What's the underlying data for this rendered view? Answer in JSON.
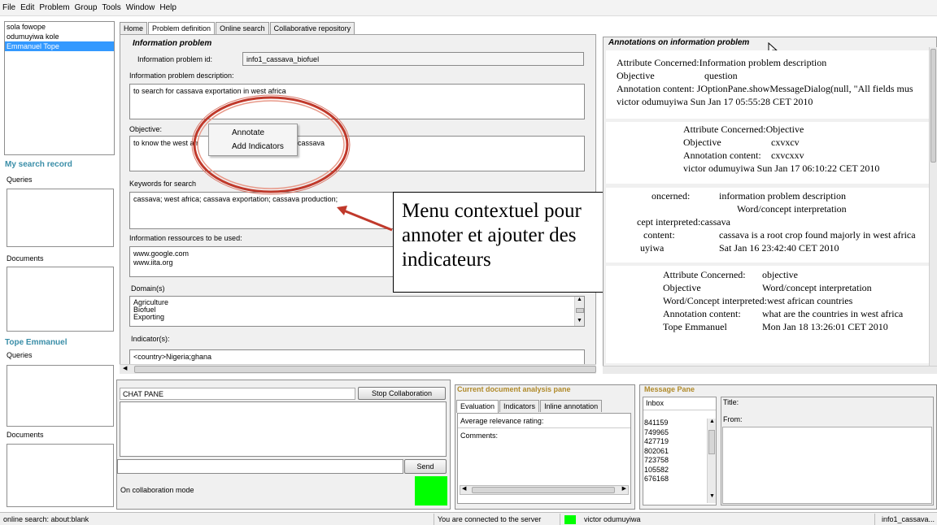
{
  "menubar": [
    "File",
    "Edit",
    "Problem",
    "Group",
    "Tools",
    "Window",
    "Help"
  ],
  "users": [
    {
      "name": "sola fowope",
      "selected": false
    },
    {
      "name": "odumuyiwa kole",
      "selected": false
    },
    {
      "name": "Emmanuel Tope",
      "selected": true
    }
  ],
  "sidebar": {
    "my_search_record": "My search record",
    "queries": "Queries",
    "documents": "Documents",
    "tope_heading": "Tope Emmanuel",
    "queries2": "Queries",
    "documents2": "Documents"
  },
  "tabs": [
    {
      "label": "Home",
      "active": false
    },
    {
      "label": "Problem definition",
      "active": true
    },
    {
      "label": "Online search",
      "active": false
    },
    {
      "label": "Collaborative repository",
      "active": false
    }
  ],
  "form": {
    "section_title": "Information problem",
    "id_label": "Information problem id:",
    "id_value": "info1_cassava_biofuel",
    "desc_label": "Information problem description:",
    "desc_value": "to search for cassava exportation in west africa",
    "objective_label": "Objective:",
    "objective_value_a": "to know the west afr",
    "objective_value_b": "cassava",
    "keywords_label": "Keywords for search",
    "keywords_value": "cassava; west africa; cassava exportation; cassava production;",
    "resources_label": "Information ressources to be used:",
    "resources_values": [
      "www.google.com",
      "www.iita.org"
    ],
    "domain_label": "Domain(s)",
    "domain_values": [
      "Agriculture",
      "Biofuel",
      "Exporting"
    ],
    "indicator_label": "Indicator(s):",
    "indicator_value": "<country>Nigeria;ghana"
  },
  "context_menu": [
    "Annotate",
    "Add Indicators"
  ],
  "callout_text": "Menu contextuel pour annoter et ajouter des indicateurs",
  "annotations": {
    "title": "Annotations on information problem",
    "a1": {
      "attr": "Attribute Concerned:Information problem description",
      "obj_label": "Objective",
      "obj_value": "question",
      "content": "Annotation content:  JOptionPane.showMessageDialog(null, \"All fields mus",
      "author": "victor odumuyiwa   Sun Jan 17 05:55:28 CET 2010"
    },
    "a2": {
      "attr": "Attribute Concerned:Objective",
      "obj_label": "Objective",
      "obj_value": "cxvxcv",
      "content_label": "Annotation content:",
      "content_value": "cxvcxxv",
      "author": "victor odumuyiwa   Sun Jan 17 06:10:22 CET 2010"
    },
    "a3": {
      "line1_label": "oncerned:",
      "line1_value": "information problem description",
      "line2_value": "Word/concept interpretation",
      "line3": "cept interpreted:cassava",
      "line4_label": "content:",
      "line4_value": "cassava is a root crop found majorly in west africa",
      "line5_label": "uyiwa",
      "line5_value": "Sat Jan 16 23:42:40 CET 2010"
    },
    "a4": {
      "attr_label": "Attribute Concerned:",
      "attr_value": "objective",
      "obj_label": "Objective",
      "obj_value": "Word/concept interpretation",
      "interp": "Word/Concept interpreted:west african countries",
      "content_label": "Annotation content:",
      "content_value": "what are the countries in west africa",
      "author_label": "Tope Emmanuel",
      "author_value": "Mon Jan 18 13:26:01 CET 2010"
    }
  },
  "chat": {
    "title": "CHAT PANE",
    "stop_button": "Stop Collaboration",
    "send_button": "Send",
    "mode_label": "On collaboration mode",
    "mode_color": "#00ff00"
  },
  "doc_analysis": {
    "title": "Current document analysis pane",
    "tabs": [
      "Evaluation",
      "Indicators",
      "Inline annotation"
    ],
    "relevance_label": "Average relevance rating:",
    "comments_label": "Comments:"
  },
  "message_pane": {
    "title": "Message Pane",
    "inbox_label": "Inbox",
    "inbox_items": [
      "841159",
      "749965",
      "427719",
      "802061",
      "723758",
      "105582",
      "676168"
    ],
    "title_label": "Title:",
    "from_label": "From:"
  },
  "statusbar": {
    "left": "online search: about:blank",
    "connected": "You are connected to the server",
    "user": "victor odumuyiwa",
    "problem": "info1_cassava..."
  },
  "colors": {
    "accent_heading": "#3a8ea8",
    "panel_heading": "#b08a2a",
    "selection": "#3399ff",
    "callout_ellipse": "#c0392b",
    "online": "#00ff00"
  }
}
